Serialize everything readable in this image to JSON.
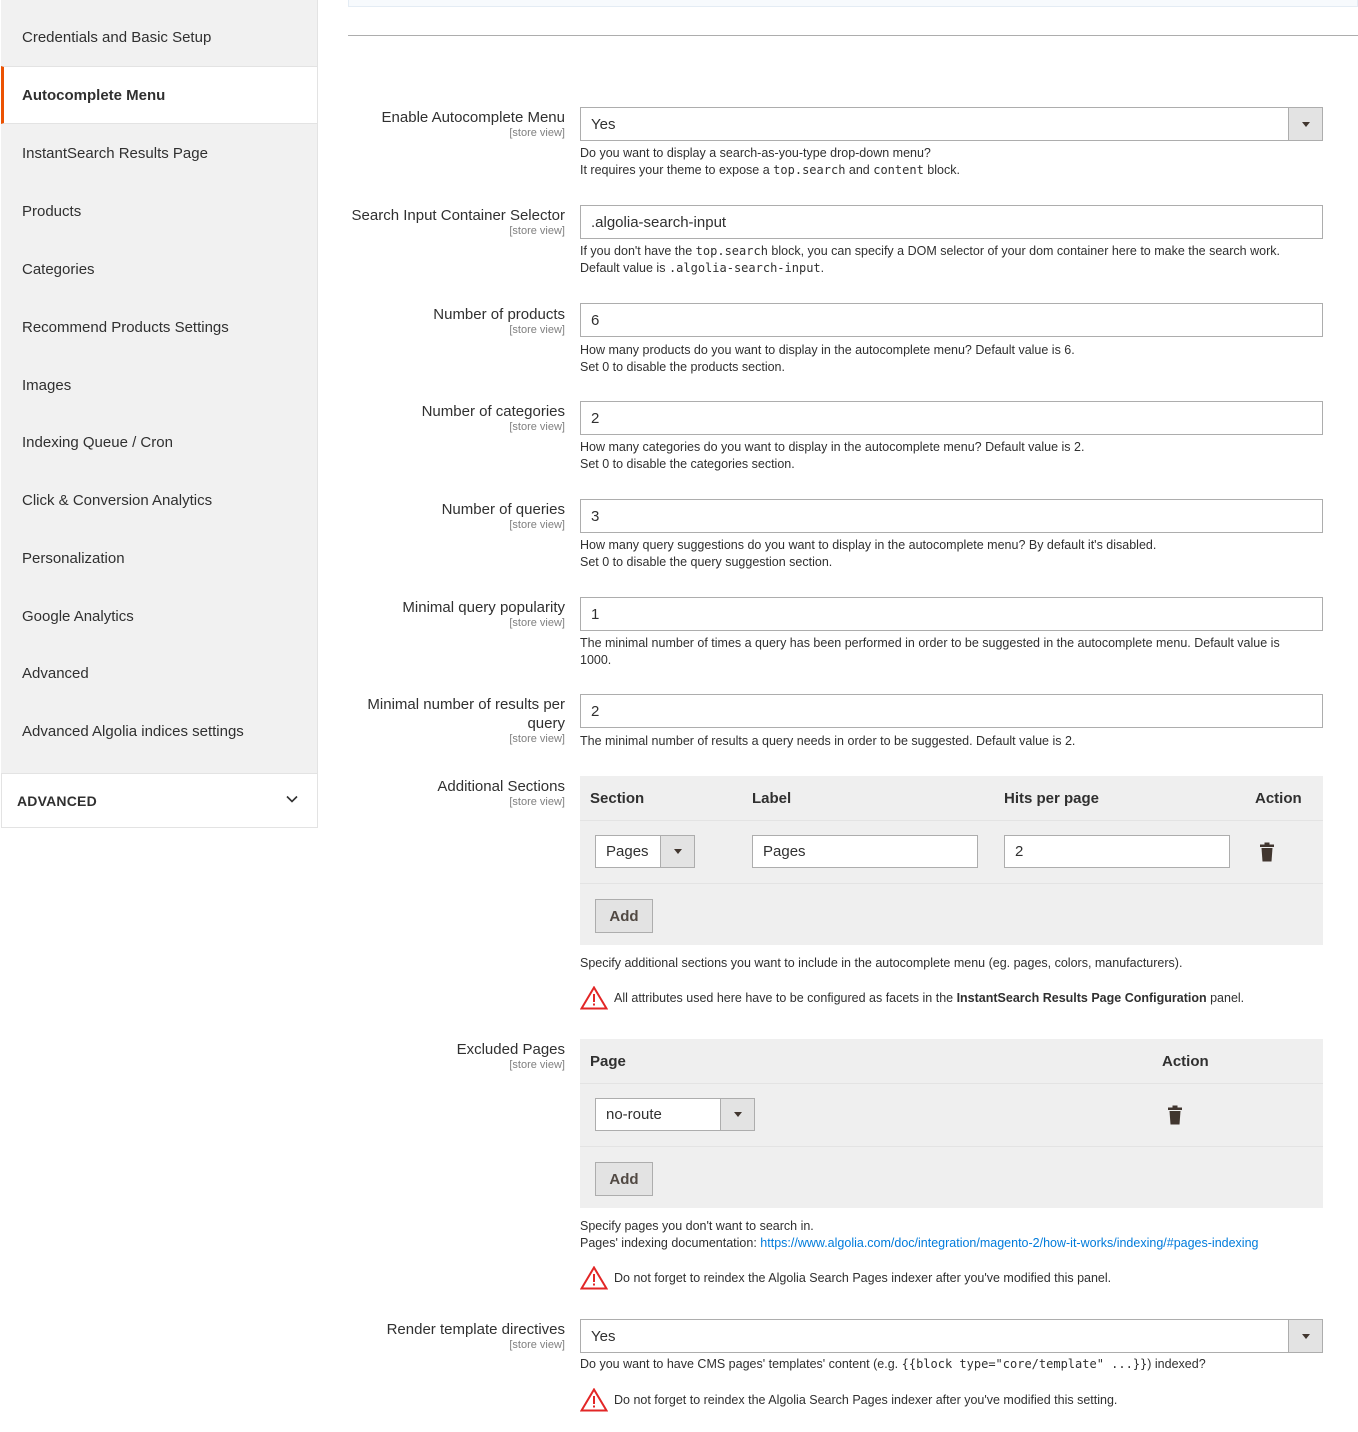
{
  "sidebar": {
    "items": [
      {
        "label": "Credentials and Basic Setup",
        "active": false
      },
      {
        "label": "Autocomplete Menu",
        "active": true
      },
      {
        "label": "InstantSearch Results Page",
        "active": false
      },
      {
        "label": "Products",
        "active": false
      },
      {
        "label": "Categories",
        "active": false
      },
      {
        "label": "Recommend Products Settings",
        "active": false
      },
      {
        "label": "Images",
        "active": false
      },
      {
        "label": "Indexing Queue / Cron",
        "active": false
      },
      {
        "label": "Click & Conversion Analytics",
        "active": false
      },
      {
        "label": "Personalization",
        "active": false
      },
      {
        "label": "Google Analytics",
        "active": false
      },
      {
        "label": "Advanced",
        "active": false
      },
      {
        "label": "Advanced Algolia indices settings",
        "active": false
      }
    ],
    "section_label": "ADVANCED"
  },
  "scope_label": "[store view]",
  "fields": {
    "enable_autocomplete": {
      "label": "Enable Autocomplete Menu",
      "value": "Yes",
      "note_1": "Do you want to display a search-as-you-type drop-down menu?",
      "note_2a": "It requires your theme to expose a ",
      "note_2_code1": "top.search",
      "note_2b": " and ",
      "note_2_code2": "content",
      "note_2c": " block."
    },
    "search_input_selector": {
      "label": "Search Input Container Selector",
      "value": ".algolia-search-input",
      "note_1a": "If you don't have the ",
      "note_1_code": "top.search",
      "note_1b": " block, you can specify a DOM selector of your dom container here to make the search work.",
      "note_2a": "Default value is ",
      "note_2_code": ".algolia-search-input",
      "note_2b": "."
    },
    "number_of_products": {
      "label": "Number of products",
      "value": "6",
      "note_1": "How many products do you want to display in the autocomplete menu? Default value is 6.",
      "note_2": "Set 0 to disable the products section."
    },
    "number_of_categories": {
      "label": "Number of categories",
      "value": "2",
      "note_1": "How many categories do you want to display in the autocomplete menu? Default value is 2.",
      "note_2": "Set 0 to disable the categories section."
    },
    "number_of_queries": {
      "label": "Number of queries",
      "value": "3",
      "note_1": "How many query suggestions do you want to display in the autocomplete menu? By default it's disabled.",
      "note_2": "Set 0 to disable the query suggestion section."
    },
    "minimal_query_popularity": {
      "label": "Minimal query popularity",
      "value": "1",
      "note_1": "The minimal number of times a query has been performed in order to be suggested in the autocomplete menu. Default value is",
      "note_2": "1000."
    },
    "minimal_results_per_query": {
      "label_1": "Minimal number of results per",
      "label_2": "query",
      "value": "2",
      "note_1": "The minimal number of results a query needs in order to be suggested. Default value is 2."
    },
    "additional_sections": {
      "label": "Additional Sections",
      "columns": [
        "Section",
        "Label",
        "Hits per page",
        "Action"
      ],
      "rows": [
        {
          "section": "Pages",
          "label": "Pages",
          "hits": "2"
        }
      ],
      "add_label": "Add",
      "note_1": "Specify additional sections you want to include in the autocomplete menu (eg. pages, colors, manufacturers).",
      "warn_a": "All attributes used here have to be configured as facets in the ",
      "warn_bold": "InstantSearch Results Page Configuration",
      "warn_b": " panel."
    },
    "excluded_pages": {
      "label": "Excluded Pages",
      "columns": [
        "Page",
        "Action"
      ],
      "rows": [
        {
          "page": "no-route"
        }
      ],
      "add_label": "Add",
      "note_1": "Specify pages you don't want to search in.",
      "note_2a": "Pages' indexing documentation: ",
      "note_2_link": "https://www.algolia.com/doc/integration/magento-2/how-it-works/indexing/#pages-indexing",
      "warn": "Do not forget to reindex the Algolia Search Pages indexer after you've modified this panel."
    },
    "render_template_directives": {
      "label": "Render template directives",
      "value": "Yes",
      "note_1a": "Do you want to have CMS pages' templates' content (e.g. ",
      "note_1_code": "{{block type=\"core/template\" ...}}",
      "note_1b": ") indexed?",
      "warn": "Do not forget to reindex the Algolia Search Pages indexer after you've modified this setting."
    }
  },
  "colors": {
    "accent": "#eb5202",
    "link": "#007bdb",
    "warning": "#e22626"
  }
}
